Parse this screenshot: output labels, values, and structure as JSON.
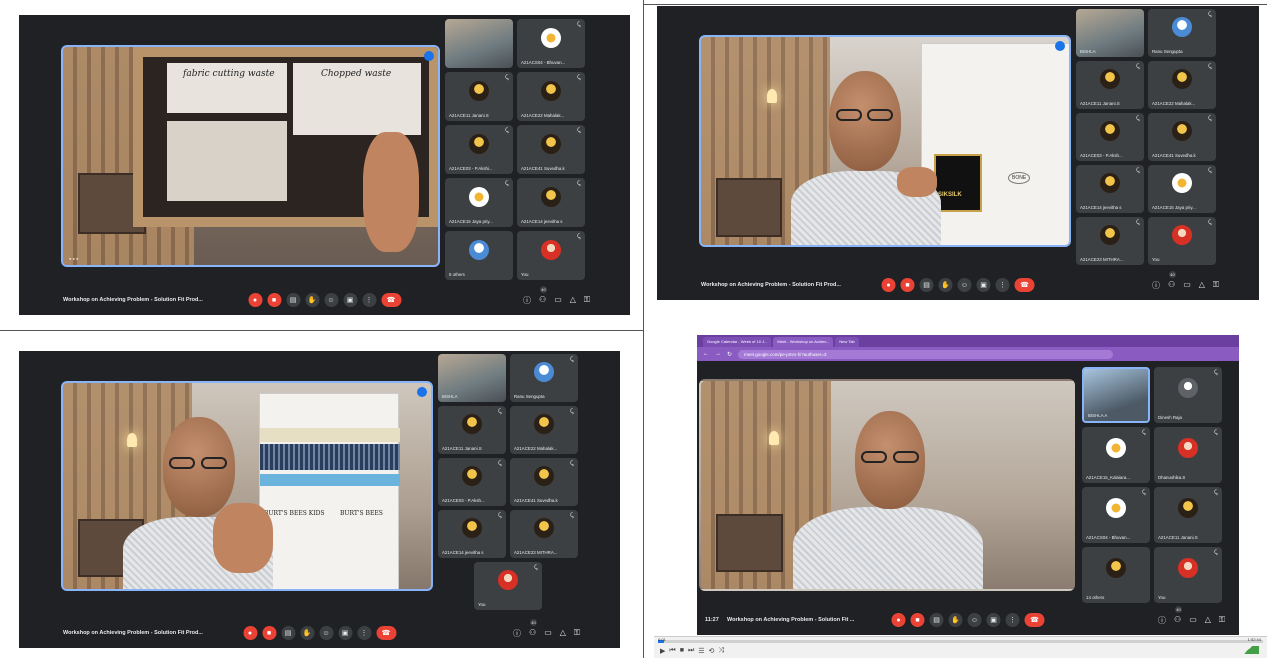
{
  "meeting_title": "Workshop on Achieving Problem - Solution Fit Prod...",
  "meeting_title_with_time": "Workshop on Achieving Problem - Solution Fit ...",
  "clock": "11:27",
  "panels": [
    {
      "id": "top-left",
      "participants_badge": "40",
      "tiles": [
        {
          "name": "",
          "avatar": "cam"
        },
        {
          "name": "A21ACS04 - Bhuvan...",
          "avatar": "white"
        },
        {
          "name": "A21ACE11 Janani.S",
          "avatar": "crest"
        },
        {
          "name": "A21ACE22 Mahalak...",
          "avatar": "crest"
        },
        {
          "name": "A21ACE03 - P.Akshi...",
          "avatar": "crest"
        },
        {
          "name": "A21ACE41 Suvedha.k",
          "avatar": "crest"
        },
        {
          "name": "A21ACE15 Jaya priy...",
          "avatar": "white"
        },
        {
          "name": "A21ACE14 jeevitha s",
          "avatar": "crest"
        },
        {
          "name": "5 others",
          "avatar": "white"
        },
        {
          "name": "You",
          "avatar": "red"
        }
      ],
      "board_text": [
        "fabric cutting waste",
        "Chopped waste"
      ]
    },
    {
      "id": "top-right",
      "participants_badge": "40",
      "tiles": [
        {
          "name": "BISHLA",
          "avatar": "cam"
        },
        {
          "name": "Ranu Sengupta",
          "avatar": "blue"
        },
        {
          "name": "A21ACE11 Janani.S",
          "avatar": "crest"
        },
        {
          "name": "A21ACE22 Mahalak...",
          "avatar": "crest"
        },
        {
          "name": "A21ACE03 - P.Aksh...",
          "avatar": "crest"
        },
        {
          "name": "A21ACE41 Suvedha.k",
          "avatar": "crest"
        },
        {
          "name": "A21ACE14 jeevitha s",
          "avatar": "crest"
        },
        {
          "name": "A21ACE15 Jaya priy...",
          "avatar": "white"
        },
        {
          "name": "A21ACE23 MITHRA...",
          "avatar": "crest"
        },
        {
          "name": "You",
          "avatar": "red"
        }
      ],
      "board_text": [
        "BONE",
        "SIKSILK"
      ]
    },
    {
      "id": "bottom-left",
      "participants_badge": "40",
      "tiles": [
        {
          "name": "BISHLA",
          "avatar": "cam"
        },
        {
          "name": "Ranu Sengupta",
          "avatar": "blue"
        },
        {
          "name": "A21ACE11 Janani.S",
          "avatar": "crest"
        },
        {
          "name": "A21ACE22 Mahalak...",
          "avatar": "crest"
        },
        {
          "name": "A21ACE03 - P.Aksh...",
          "avatar": "crest"
        },
        {
          "name": "A21ACE41 Suvedha.k",
          "avatar": "crest"
        },
        {
          "name": "A21ACE14 jeevitha s",
          "avatar": "crest"
        },
        {
          "name": "A21ACE23 MITHRA...",
          "avatar": "crest"
        },
        {
          "name": "You",
          "avatar": "red"
        }
      ],
      "board_text": [
        "BURT'S BEES KIDS",
        "BURT'S BEES"
      ]
    },
    {
      "id": "bottom-right",
      "participants_badge": "40",
      "tiles": [
        {
          "name": "BISHLA A",
          "avatar": "cam2"
        },
        {
          "name": "Dinesh Raja",
          "avatar": "grey"
        },
        {
          "name": "A21ACE15_Kalaiara...",
          "avatar": "white"
        },
        {
          "name": "Dhanushika.S",
          "avatar": "red"
        },
        {
          "name": "A21ACS04 - Bhuvan...",
          "avatar": "white"
        },
        {
          "name": "A21ACE11 Janani.S",
          "avatar": "crest"
        },
        {
          "name": "14 others",
          "avatar": "crest"
        },
        {
          "name": "You",
          "avatar": "red"
        }
      ]
    }
  ],
  "browser": {
    "tabs": [
      "Google Calendar - Week of 10 J...",
      "Meet - Workshop on Achiev...",
      "New Tab"
    ],
    "url": "meet.google.com/pe-pmrv-hi?authuser=3"
  },
  "player": {
    "elapsed": "0:01",
    "total": "1:52:44",
    "progress_fraction": 0.01
  },
  "icons": [
    "mic-icon",
    "camera-icon",
    "captions-icon",
    "hand-icon",
    "emoji-icon",
    "present-icon",
    "more-icon",
    "end-call-icon",
    "info-icon",
    "people-icon",
    "chat-icon",
    "activities-icon",
    "lock-icon"
  ]
}
